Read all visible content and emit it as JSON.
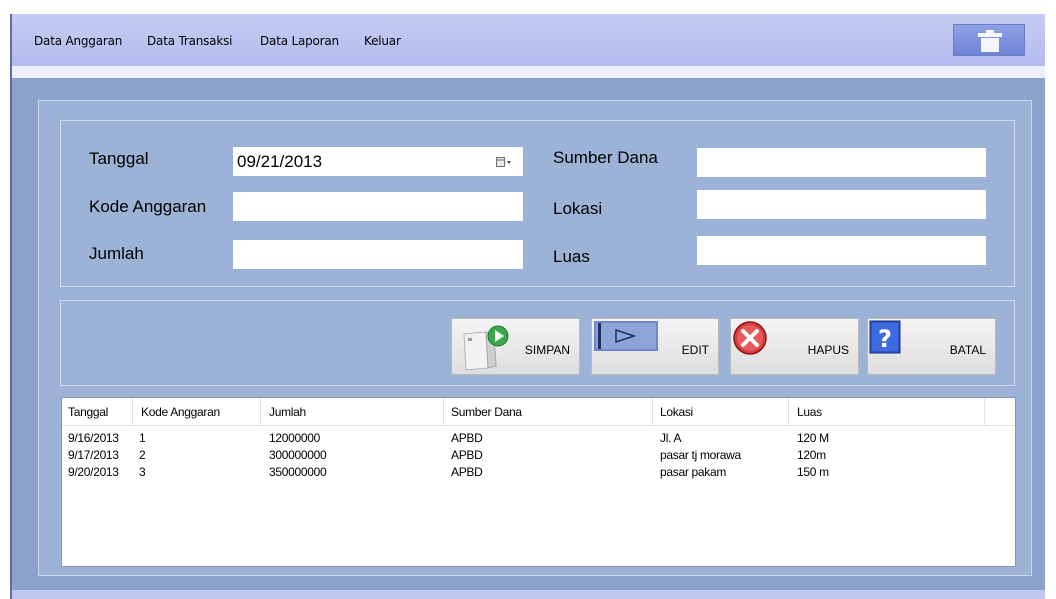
{
  "menu": {
    "items": [
      {
        "label": "Data Anggaran"
      },
      {
        "label": "Data Transaksi"
      },
      {
        "label": "Data Laporan"
      },
      {
        "label": "Keluar"
      }
    ],
    "trash_icon": "trash-icon"
  },
  "form": {
    "tanggal_label": "Tanggal",
    "tanggal_value": "09/21/2013",
    "kode_label": "Kode Anggaran",
    "kode_value": "",
    "jumlah_label": "Jumlah",
    "jumlah_value": "",
    "sumber_label": "Sumber Dana",
    "sumber_value": "",
    "lokasi_label": "Lokasi",
    "lokasi_value": "",
    "luas_label": "Luas",
    "luas_value": ""
  },
  "buttons": {
    "simpan": "SIMPAN",
    "edit": "EDIT",
    "hapus": "HAPUS",
    "batal": "BATAL"
  },
  "table": {
    "columns": [
      "Tanggal",
      "Kode Anggaran",
      "Jumlah",
      "Sumber Dana",
      "Lokasi",
      "Luas"
    ],
    "rows": [
      [
        "9/16/2013",
        "1",
        "12000000",
        "APBD",
        "Jl. A",
        "120 M"
      ],
      [
        "9/17/2013",
        "2",
        "300000000",
        "APBD",
        "pasar tj morawa",
        "120m"
      ],
      [
        "9/20/2013",
        "3",
        "350000000",
        "APBD",
        "pasar pakam",
        "150 m"
      ]
    ]
  },
  "colors": {
    "menubar": "#b3bcef",
    "panel": "#9cb2d6",
    "background": "#8ba3cc"
  }
}
